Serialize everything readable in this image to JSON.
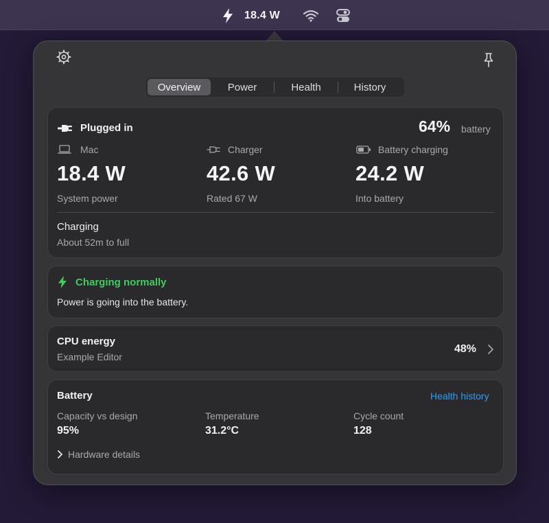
{
  "menubar": {
    "watts": "18.4 W",
    "icons": [
      "bolt-icon",
      "wifi-icon",
      "control-center-icon"
    ]
  },
  "tabs": [
    {
      "label": "Overview",
      "selected": true
    },
    {
      "label": "Power",
      "selected": false
    },
    {
      "label": "Health",
      "selected": false
    },
    {
      "label": "History",
      "selected": false
    }
  ],
  "power_card": {
    "status_label": "Plugged in",
    "battery_percent": "64%",
    "battery_label": "battery",
    "columns": [
      {
        "icon": "laptop-icon",
        "label": "Mac",
        "value": "18.4 W",
        "caption": "System power"
      },
      {
        "icon": "plug-icon",
        "label": "Charger",
        "value": "42.6 W",
        "caption": "Rated 67 W"
      },
      {
        "icon": "battery-icon",
        "label": "Battery charging",
        "value": "24.2 W",
        "caption": "Into battery"
      }
    ],
    "charging_title": "Charging",
    "charging_eta": "About 52m to full"
  },
  "status_card": {
    "title": "Charging normally",
    "message": "Power is going into the battery."
  },
  "cpu_card": {
    "title": "CPU energy",
    "app": "Example Editor",
    "percent": "48%"
  },
  "battery_card": {
    "title": "Battery",
    "link": "Health history",
    "stats": [
      {
        "label": "Capacity vs design",
        "value": "95%"
      },
      {
        "label": "Temperature",
        "value": "31.2°C"
      },
      {
        "label": "Cycle count",
        "value": "128"
      }
    ],
    "disclosure": "Hardware details"
  },
  "colors": {
    "accent_green": "#3fcd5c",
    "link_blue": "#2f9cf5",
    "panel_bg": "#353537",
    "card_bg": "#2a2a2c",
    "desktop_bg": "#231a37"
  }
}
